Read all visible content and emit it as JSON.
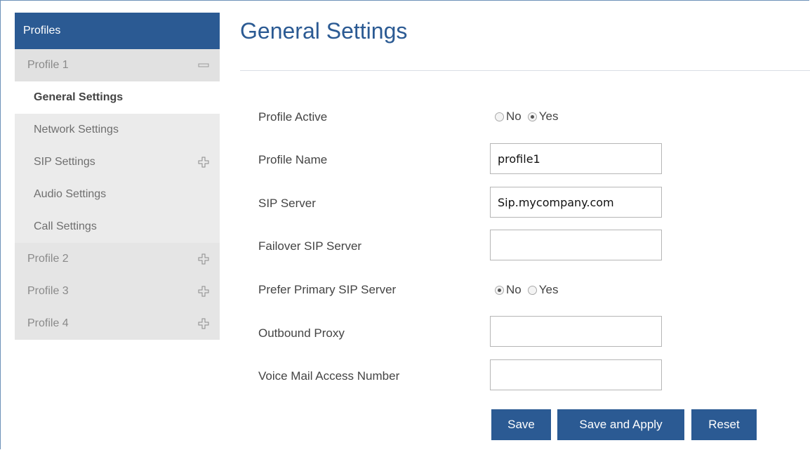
{
  "sidebar": {
    "header": "Profiles",
    "profile1": {
      "label": "Profile 1",
      "items": [
        {
          "label": "General Settings"
        },
        {
          "label": "Network Settings"
        },
        {
          "label": "SIP Settings"
        },
        {
          "label": "Audio Settings"
        },
        {
          "label": "Call Settings"
        }
      ]
    },
    "profiles": [
      {
        "label": "Profile 2"
      },
      {
        "label": "Profile 3"
      },
      {
        "label": "Profile 4"
      }
    ]
  },
  "main": {
    "title": "General Settings",
    "profile_active": {
      "label": "Profile Active",
      "options": [
        "No",
        "Yes"
      ],
      "selected": "Yes"
    },
    "profile_name": {
      "label": "Profile Name",
      "value": "profile1"
    },
    "sip_server": {
      "label": "SIP Server",
      "value": "Sip.mycompany.com"
    },
    "failover_sip_server": {
      "label": "Failover SIP Server",
      "value": ""
    },
    "prefer_primary": {
      "label": "Prefer Primary SIP Server",
      "options": [
        "No",
        "Yes"
      ],
      "selected": "No"
    },
    "outbound_proxy": {
      "label": "Outbound Proxy",
      "value": ""
    },
    "voice_mail": {
      "label": "Voice Mail Access Number",
      "value": ""
    }
  },
  "buttons": {
    "save": "Save",
    "save_apply": "Save and Apply",
    "reset": "Reset"
  },
  "colors": {
    "accent": "#2b5a93",
    "sidebar_bg": "#ebebeb"
  }
}
